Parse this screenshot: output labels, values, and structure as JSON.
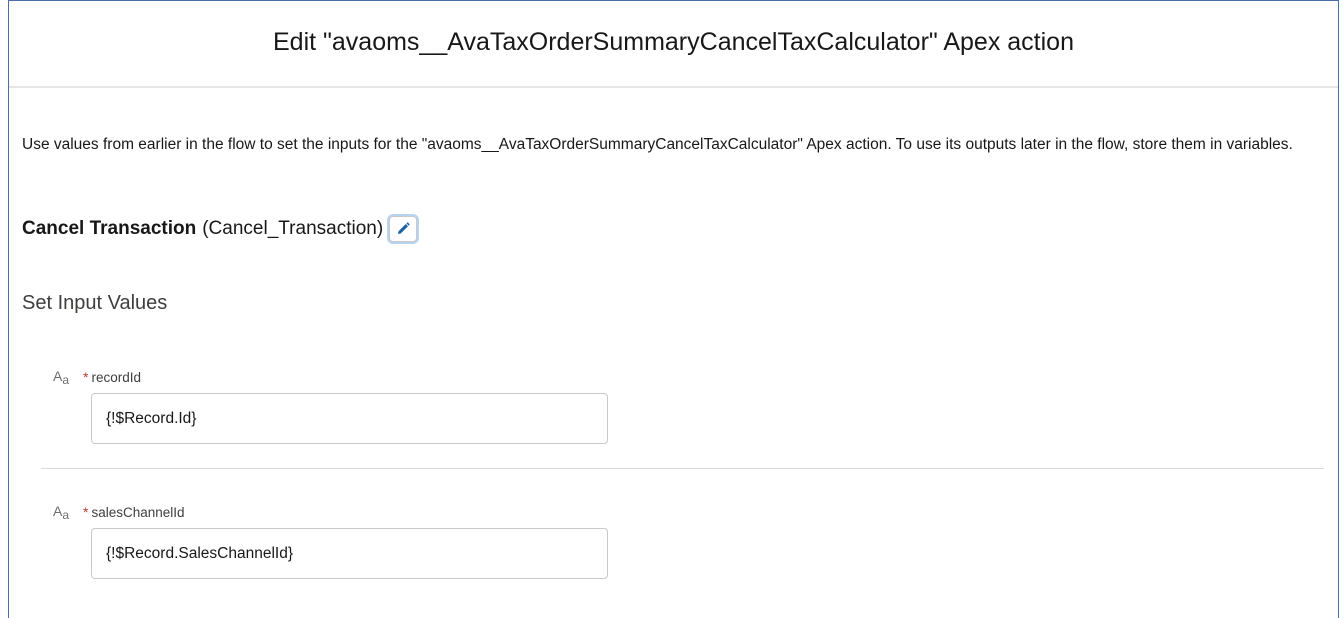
{
  "modal": {
    "title": "Edit \"avaoms__AvaTaxOrderSummaryCancelTaxCalculator\" Apex action",
    "description": "Use values from earlier in the flow to set the inputs for the \"avaoms__AvaTaxOrderSummaryCancelTaxCalculator\" Apex action. To use its outputs later in the flow, store them in variables."
  },
  "element": {
    "label": "Cancel Transaction",
    "api_name": "(Cancel_Transaction)",
    "edit_icon": "pencil-icon"
  },
  "inputs_section": {
    "title": "Set Input Values",
    "type_icon": "text-type-icon",
    "type_icon_main": "A",
    "type_icon_sub": "a",
    "required_marker": "*",
    "params": [
      {
        "label": "recordId",
        "value": "{!$Record.Id}"
      },
      {
        "label": "salesChannelId",
        "value": "{!$Record.SalesChannelId}"
      }
    ]
  },
  "colors": {
    "border_accent": "#4a6fa8",
    "edit_icon": "#1b5fa8",
    "required": "#c23934"
  }
}
